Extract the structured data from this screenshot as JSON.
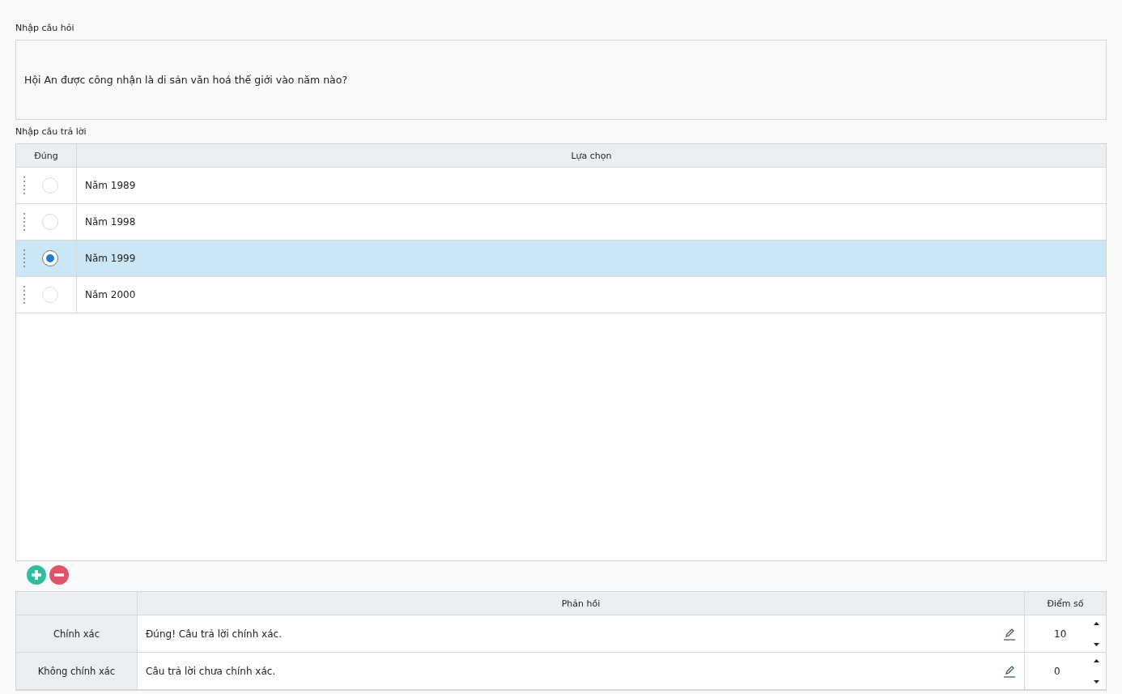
{
  "question": {
    "label": "Nhập câu hỏi",
    "value": "Hội An được công nhận là di sản văn hoá thế giới vào năm nào?"
  },
  "answers": {
    "label": "Nhập câu trả lời",
    "columns": [
      "Đúng",
      "Lựa chọn"
    ],
    "rows": [
      {
        "text": "Năm 1989",
        "selected": false
      },
      {
        "text": "Năm 1998",
        "selected": false
      },
      {
        "text": "Năm 1999",
        "selected": true
      },
      {
        "text": "Năm 2000",
        "selected": false
      }
    ]
  },
  "feedback": {
    "columns": [
      "Phản hồi",
      "Điểm số"
    ],
    "rows": [
      {
        "label": "Chính xác",
        "text": "Đúng! Câu trả lời chính xác.",
        "score": "10"
      },
      {
        "label": "Không chính xác",
        "text": "Câu trả lời chưa chính xác.",
        "score": "0"
      }
    ]
  }
}
